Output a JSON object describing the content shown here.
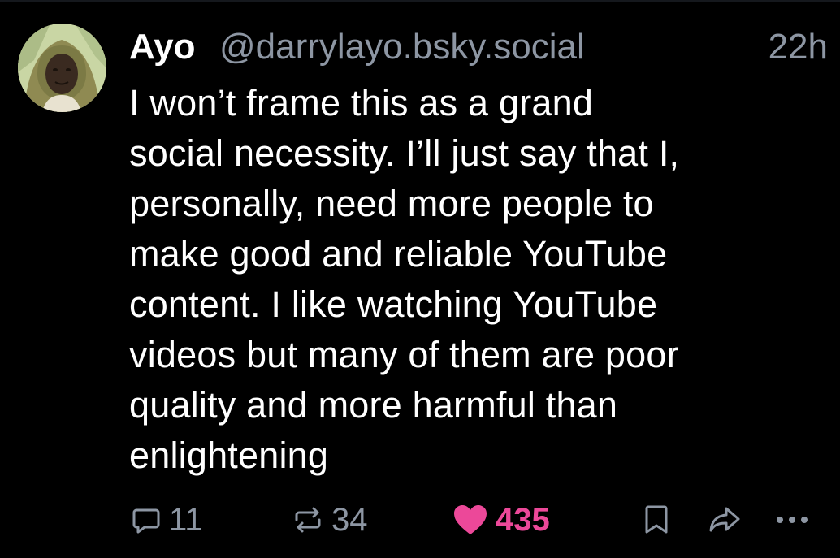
{
  "post": {
    "author": {
      "display_name": "Ayo",
      "handle": "@darrylayo.bsky.social",
      "avatar_icon": "user-avatar-photo"
    },
    "timestamp": "22h",
    "text": "I won’t frame this as a grand\nsocial necessity. I’ll just say that I,\npersonally, need more people to\nmake good and reliable YouTube\ncontent. I like watching YouTube\nvideos but many of them are poor\nquality and more harmful than\nenlightening",
    "stats": {
      "replies": "11",
      "reposts": "34",
      "likes": "435",
      "liked": true
    },
    "actions": {
      "reply_icon": "reply-bubble-icon",
      "repost_icon": "repost-icon",
      "like_icon": "heart-icon",
      "bookmark_icon": "bookmark-icon",
      "share_icon": "share-arrow-icon",
      "more_icon": "more-dots-icon"
    }
  },
  "colors": {
    "background": "#000000",
    "text": "#ffffff",
    "muted": "#8d96a3",
    "like_accent": "#ec4899"
  }
}
